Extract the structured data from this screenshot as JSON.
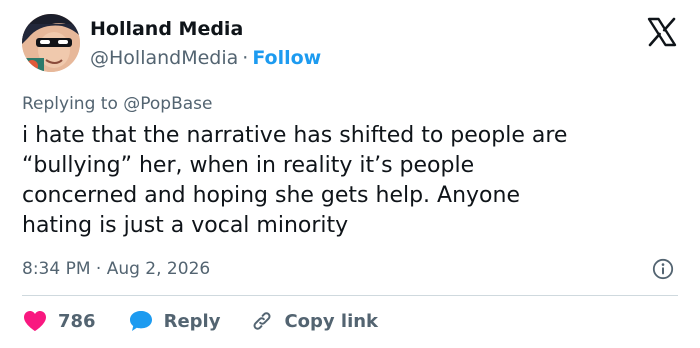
{
  "author": {
    "display_name": "Holland Media",
    "handle": "@HollandMedia",
    "separator": "·",
    "follow_label": "Follow",
    "avatar_icon": "cartoon-avatar-icon"
  },
  "brand": {
    "logo_icon": "x-logo-icon"
  },
  "reply_context": {
    "prefix": "Replying to",
    "mention": "@PopBase"
  },
  "tweet": {
    "lines": [
      "i hate that the narrative has shifted to people are",
      "“bullying” her, when in reality it’s people",
      "concerned and hoping she gets help. Anyone",
      "hating is just a vocal minority"
    ],
    "timestamp": "8:34 PM · Aug 2, 2026",
    "info_icon": "info-icon"
  },
  "actions": {
    "like_count": "786",
    "like_icon": "heart-icon",
    "reply_label": "Reply",
    "reply_icon": "speech-bubble-icon",
    "copy_label": "Copy link",
    "copy_icon": "link-icon"
  },
  "colors": {
    "text": "#0f1419",
    "secondary_text": "#536471",
    "accent_blue": "#1d9bf0",
    "like_pink": "#f91880",
    "divider": "#cfd9de"
  }
}
